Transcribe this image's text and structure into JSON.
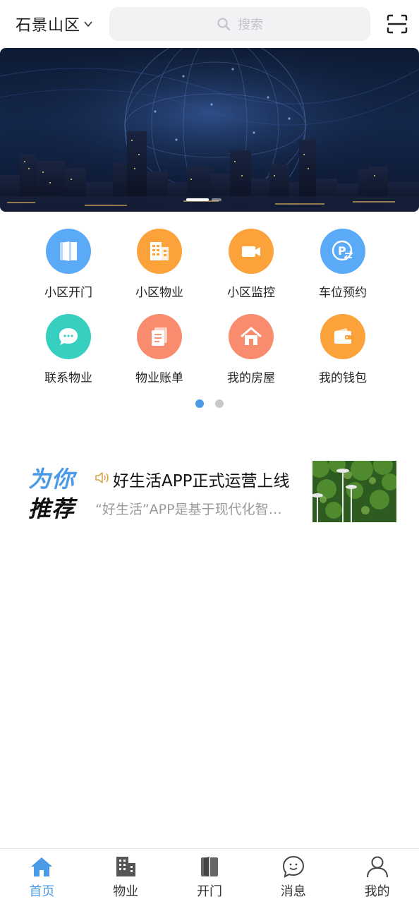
{
  "header": {
    "location": "石景山区",
    "search_placeholder": "搜索"
  },
  "banner": {
    "active_index": 0,
    "dot_count": 2
  },
  "quick_actions": [
    {
      "label": "小区开门",
      "icon": "door-icon",
      "color": "#5aaaf7"
    },
    {
      "label": "小区物业",
      "icon": "building-icon",
      "color": "#fba33a"
    },
    {
      "label": "小区监控",
      "icon": "video-camera-icon",
      "color": "#fba33a"
    },
    {
      "label": "车位预约",
      "icon": "parking-icon",
      "color": "#5aaaf7"
    },
    {
      "label": "联系物业",
      "icon": "chat-bubble-icon",
      "color": "#37cfc0"
    },
    {
      "label": "物业账单",
      "icon": "bill-icon",
      "color": "#f98c6e"
    },
    {
      "label": "我的房屋",
      "icon": "house-icon",
      "color": "#f98c6e"
    },
    {
      "label": "我的钱包",
      "icon": "wallet-icon",
      "color": "#fba33a"
    }
  ],
  "pager": {
    "active_index": 0,
    "count": 2,
    "active_color": "#4a9ae8",
    "inactive_color": "#c9c9c9"
  },
  "recommend": {
    "title_line1": "为你",
    "title_line2": "推荐",
    "headline": "好生活APP正式运营上线",
    "description": "“好生活”APP是基于现代化智慧社区服务平台"
  },
  "tabbar": {
    "active_index": 0,
    "items": [
      {
        "label": "首页",
        "icon": "home-icon"
      },
      {
        "label": "物业",
        "icon": "building-icon"
      },
      {
        "label": "开门",
        "icon": "door-icon"
      },
      {
        "label": "消息",
        "icon": "message-icon"
      },
      {
        "label": "我的",
        "icon": "user-icon"
      }
    ]
  },
  "colors": {
    "accent": "#4a9ae8"
  }
}
